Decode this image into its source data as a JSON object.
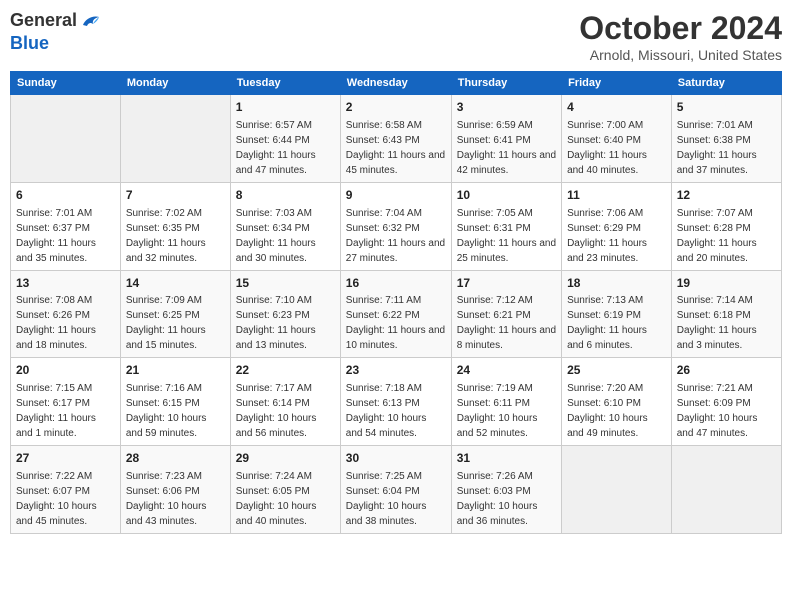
{
  "header": {
    "logo_general": "General",
    "logo_blue": "Blue",
    "title": "October 2024",
    "subtitle": "Arnold, Missouri, United States"
  },
  "days_of_week": [
    "Sunday",
    "Monday",
    "Tuesday",
    "Wednesday",
    "Thursday",
    "Friday",
    "Saturday"
  ],
  "weeks": [
    [
      {
        "day": "",
        "empty": true
      },
      {
        "day": "",
        "empty": true
      },
      {
        "day": "1",
        "sunrise": "Sunrise: 6:57 AM",
        "sunset": "Sunset: 6:44 PM",
        "daylight": "Daylight: 11 hours and 47 minutes."
      },
      {
        "day": "2",
        "sunrise": "Sunrise: 6:58 AM",
        "sunset": "Sunset: 6:43 PM",
        "daylight": "Daylight: 11 hours and 45 minutes."
      },
      {
        "day": "3",
        "sunrise": "Sunrise: 6:59 AM",
        "sunset": "Sunset: 6:41 PM",
        "daylight": "Daylight: 11 hours and 42 minutes."
      },
      {
        "day": "4",
        "sunrise": "Sunrise: 7:00 AM",
        "sunset": "Sunset: 6:40 PM",
        "daylight": "Daylight: 11 hours and 40 minutes."
      },
      {
        "day": "5",
        "sunrise": "Sunrise: 7:01 AM",
        "sunset": "Sunset: 6:38 PM",
        "daylight": "Daylight: 11 hours and 37 minutes."
      }
    ],
    [
      {
        "day": "6",
        "sunrise": "Sunrise: 7:01 AM",
        "sunset": "Sunset: 6:37 PM",
        "daylight": "Daylight: 11 hours and 35 minutes."
      },
      {
        "day": "7",
        "sunrise": "Sunrise: 7:02 AM",
        "sunset": "Sunset: 6:35 PM",
        "daylight": "Daylight: 11 hours and 32 minutes."
      },
      {
        "day": "8",
        "sunrise": "Sunrise: 7:03 AM",
        "sunset": "Sunset: 6:34 PM",
        "daylight": "Daylight: 11 hours and 30 minutes."
      },
      {
        "day": "9",
        "sunrise": "Sunrise: 7:04 AM",
        "sunset": "Sunset: 6:32 PM",
        "daylight": "Daylight: 11 hours and 27 minutes."
      },
      {
        "day": "10",
        "sunrise": "Sunrise: 7:05 AM",
        "sunset": "Sunset: 6:31 PM",
        "daylight": "Daylight: 11 hours and 25 minutes."
      },
      {
        "day": "11",
        "sunrise": "Sunrise: 7:06 AM",
        "sunset": "Sunset: 6:29 PM",
        "daylight": "Daylight: 11 hours and 23 minutes."
      },
      {
        "day": "12",
        "sunrise": "Sunrise: 7:07 AM",
        "sunset": "Sunset: 6:28 PM",
        "daylight": "Daylight: 11 hours and 20 minutes."
      }
    ],
    [
      {
        "day": "13",
        "sunrise": "Sunrise: 7:08 AM",
        "sunset": "Sunset: 6:26 PM",
        "daylight": "Daylight: 11 hours and 18 minutes."
      },
      {
        "day": "14",
        "sunrise": "Sunrise: 7:09 AM",
        "sunset": "Sunset: 6:25 PM",
        "daylight": "Daylight: 11 hours and 15 minutes."
      },
      {
        "day": "15",
        "sunrise": "Sunrise: 7:10 AM",
        "sunset": "Sunset: 6:23 PM",
        "daylight": "Daylight: 11 hours and 13 minutes."
      },
      {
        "day": "16",
        "sunrise": "Sunrise: 7:11 AM",
        "sunset": "Sunset: 6:22 PM",
        "daylight": "Daylight: 11 hours and 10 minutes."
      },
      {
        "day": "17",
        "sunrise": "Sunrise: 7:12 AM",
        "sunset": "Sunset: 6:21 PM",
        "daylight": "Daylight: 11 hours and 8 minutes."
      },
      {
        "day": "18",
        "sunrise": "Sunrise: 7:13 AM",
        "sunset": "Sunset: 6:19 PM",
        "daylight": "Daylight: 11 hours and 6 minutes."
      },
      {
        "day": "19",
        "sunrise": "Sunrise: 7:14 AM",
        "sunset": "Sunset: 6:18 PM",
        "daylight": "Daylight: 11 hours and 3 minutes."
      }
    ],
    [
      {
        "day": "20",
        "sunrise": "Sunrise: 7:15 AM",
        "sunset": "Sunset: 6:17 PM",
        "daylight": "Daylight: 11 hours and 1 minute."
      },
      {
        "day": "21",
        "sunrise": "Sunrise: 7:16 AM",
        "sunset": "Sunset: 6:15 PM",
        "daylight": "Daylight: 10 hours and 59 minutes."
      },
      {
        "day": "22",
        "sunrise": "Sunrise: 7:17 AM",
        "sunset": "Sunset: 6:14 PM",
        "daylight": "Daylight: 10 hours and 56 minutes."
      },
      {
        "day": "23",
        "sunrise": "Sunrise: 7:18 AM",
        "sunset": "Sunset: 6:13 PM",
        "daylight": "Daylight: 10 hours and 54 minutes."
      },
      {
        "day": "24",
        "sunrise": "Sunrise: 7:19 AM",
        "sunset": "Sunset: 6:11 PM",
        "daylight": "Daylight: 10 hours and 52 minutes."
      },
      {
        "day": "25",
        "sunrise": "Sunrise: 7:20 AM",
        "sunset": "Sunset: 6:10 PM",
        "daylight": "Daylight: 10 hours and 49 minutes."
      },
      {
        "day": "26",
        "sunrise": "Sunrise: 7:21 AM",
        "sunset": "Sunset: 6:09 PM",
        "daylight": "Daylight: 10 hours and 47 minutes."
      }
    ],
    [
      {
        "day": "27",
        "sunrise": "Sunrise: 7:22 AM",
        "sunset": "Sunset: 6:07 PM",
        "daylight": "Daylight: 10 hours and 45 minutes."
      },
      {
        "day": "28",
        "sunrise": "Sunrise: 7:23 AM",
        "sunset": "Sunset: 6:06 PM",
        "daylight": "Daylight: 10 hours and 43 minutes."
      },
      {
        "day": "29",
        "sunrise": "Sunrise: 7:24 AM",
        "sunset": "Sunset: 6:05 PM",
        "daylight": "Daylight: 10 hours and 40 minutes."
      },
      {
        "day": "30",
        "sunrise": "Sunrise: 7:25 AM",
        "sunset": "Sunset: 6:04 PM",
        "daylight": "Daylight: 10 hours and 38 minutes."
      },
      {
        "day": "31",
        "sunrise": "Sunrise: 7:26 AM",
        "sunset": "Sunset: 6:03 PM",
        "daylight": "Daylight: 10 hours and 36 minutes."
      },
      {
        "day": "",
        "empty": true
      },
      {
        "day": "",
        "empty": true
      }
    ]
  ]
}
